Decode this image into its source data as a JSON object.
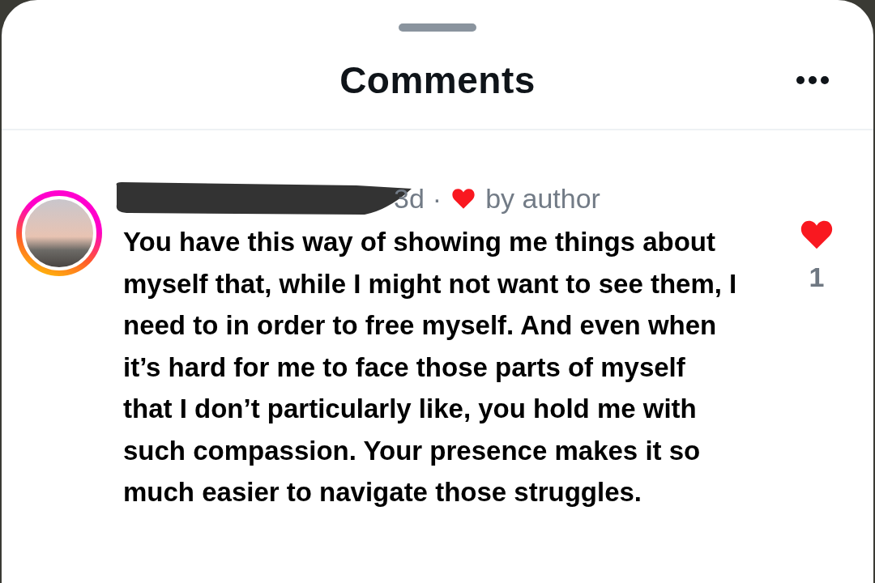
{
  "sheet": {
    "title": "Comments"
  },
  "comment": {
    "time": "3d",
    "separator": "·",
    "liked_by_author": true,
    "liked_by_author_label": "by author",
    "text": "You have this way of showing me things about myself that, while I might not want to see them, I need to in order to free myself. And even when it’s hard for me to face those parts of myself that I don’t particularly like, you hold me with such compassion. Your presence makes it so much easier to navigate those struggles.",
    "liked": true,
    "like_count": "1"
  }
}
